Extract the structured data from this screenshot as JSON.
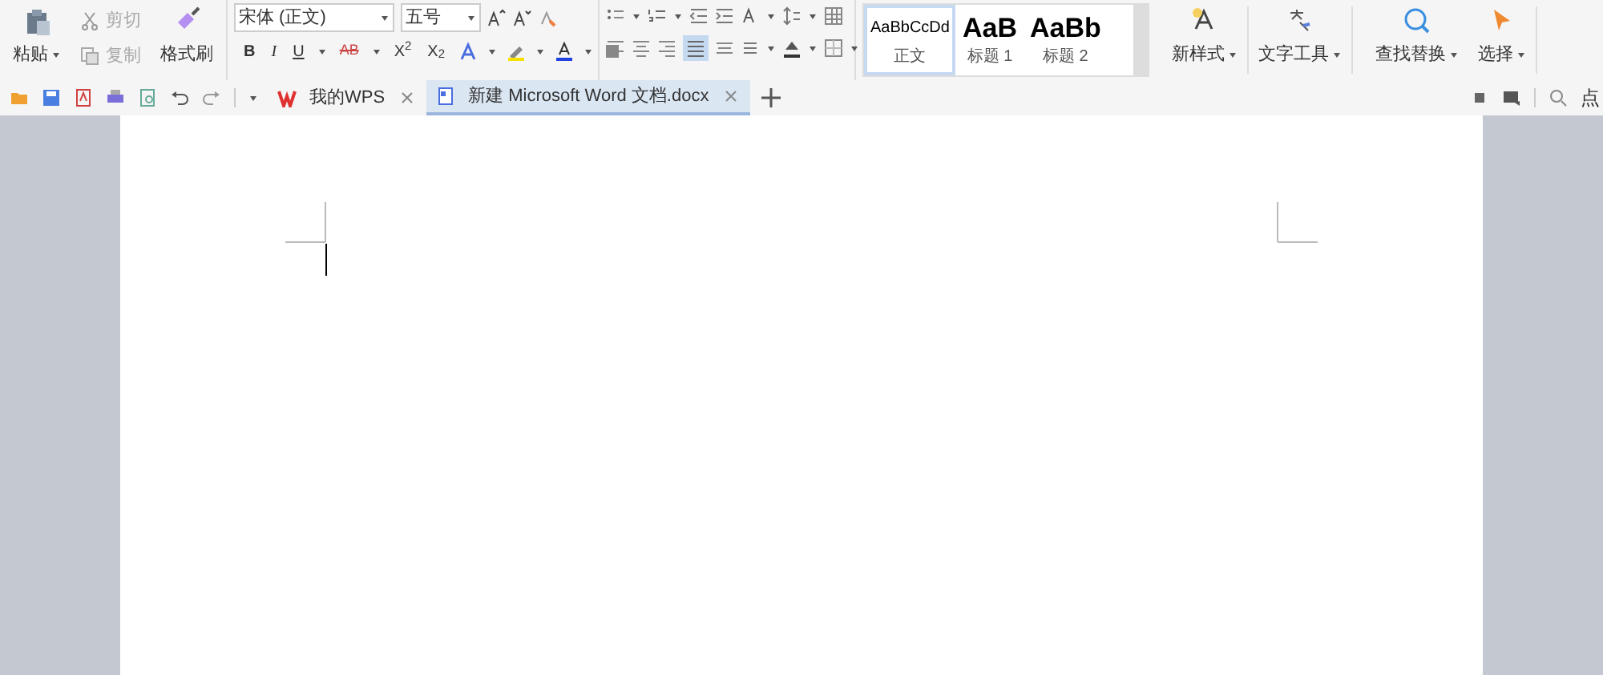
{
  "clipboard": {
    "paste": "粘贴",
    "cut": {
      "label": "剪切",
      "disabled": true
    },
    "copy": {
      "label": "复制",
      "disabled": true
    },
    "format_painter": "格式刷"
  },
  "font": {
    "name": "宋体 (正文)",
    "size": "五号",
    "format_buttons": [
      "B",
      "I",
      "U",
      "AB",
      "X$^{2}$",
      "X$_{2}$"
    ]
  },
  "styles": [
    {
      "preview": "AaBbCcDd",
      "label": "正文",
      "selected": true
    },
    {
      "preview": "AaB",
      "label": "标题 1",
      "selected": false
    },
    {
      "preview": "AaBb",
      "label": "标题 2",
      "selected": false
    }
  ],
  "tools": [
    "新样式",
    "文字工具",
    "查找替换",
    "选择"
  ],
  "tabs": [
    {
      "label": "我的WPS",
      "selected": false
    },
    {
      "label": "新建 Microsoft Word 文档.docx",
      "selected": true
    }
  ],
  "search_hint": "点"
}
